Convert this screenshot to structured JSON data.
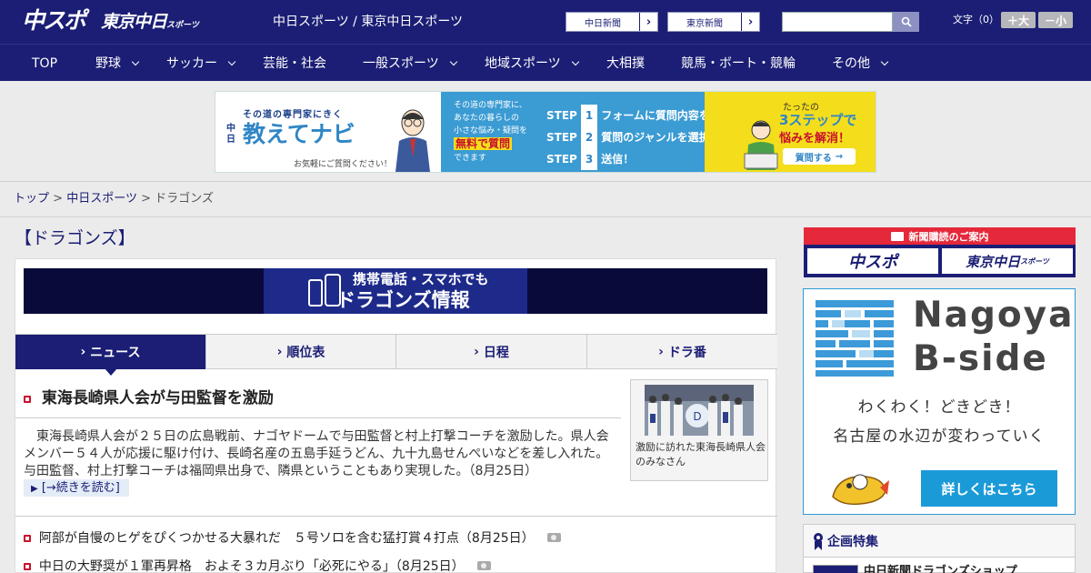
{
  "header": {
    "logo_chunichi_sports": "中スポ",
    "logo_tokyo_chunichi": "東京中日",
    "logo_tokyo_chunichi_small": "スポーツ",
    "site_title": "中日スポーツ / 東京中日スポーツ",
    "paper_links": [
      {
        "label": "中日新聞"
      },
      {
        "label": "東京新聞"
      }
    ],
    "search_value": "",
    "font_size_label": "文字（0）",
    "font_larger": "＋大",
    "font_smaller": "－小"
  },
  "nav": {
    "items": [
      {
        "label": "TOP"
      },
      {
        "label": "野球"
      },
      {
        "label": "サッカー"
      },
      {
        "label": "芸能・社会"
      },
      {
        "label": "一般スポーツ"
      },
      {
        "label": "地域スポーツ"
      },
      {
        "label": "大相撲"
      },
      {
        "label": "競馬・ボート・競輪"
      },
      {
        "label": "その他"
      }
    ]
  },
  "banner": {
    "l_tag": "その道の専門家にきく",
    "l_brand_small": "中日",
    "l_brand": "教えてナビ",
    "l_note": "お気軽にご質問ください！",
    "m_line1": "その道の専門家に、",
    "m_line2": "あなたの暮らしの",
    "m_line3": "小さな悩み・疑問を",
    "m_free": "無料で質問",
    "m_line4": "できます",
    "steps": [
      {
        "label": "STEP",
        "num": "1",
        "text": "フォームに質問内容を入力"
      },
      {
        "label": "STEP",
        "num": "2",
        "text": "質問のジャンルを選択"
      },
      {
        "label": "STEP",
        "num": "3",
        "text": "送信！"
      }
    ],
    "r_line1": "たったの",
    "r_line2": "3ステップで",
    "r_line3": "悩みを解消！",
    "r_btn": "質問する"
  },
  "breadcrumb": {
    "top": "トップ",
    "sep": ">",
    "mid": "中日スポーツ",
    "current": "ドラゴンズ"
  },
  "page_title": "【ドラゴンズ】",
  "mobile_banner": {
    "line1": "携帯電話・スマホでも",
    "line2": "ドラゴンズ情報"
  },
  "tabs": [
    {
      "label": "ニュース"
    },
    {
      "label": "順位表"
    },
    {
      "label": "日程"
    },
    {
      "label": "ドラ番"
    }
  ],
  "lead": {
    "headline": "東海長崎県人会が与田監督を激励",
    "body": "東海長崎県人会が２５日の広島戦前、ナゴヤドームで与田監督と村上打撃コーチを激励した。県人会メンバー５４人が応援に駆け付け、長崎名産の五島手延うどん、九十九島せんぺいなどを差し入れた。与田監督、村上打撃コーチは福岡県出身で、隣県ということもあり実現した。（8月25日）",
    "more": "[→続きを読む]",
    "photo_caption": "激励に訪れた東海長崎県人会のみなさん"
  },
  "news": [
    {
      "title": "阿部が自慢のヒゲをぴくつかせる大暴れだ　５号ソロを含む猛打賞４打点",
      "date": "（8月25日）"
    },
    {
      "title": "中日の大野奨が１軍再昇格　およそ３カ月ぶり「必死にやる」",
      "date": "（8月25日）"
    }
  ],
  "sidebar": {
    "subscribe_title": "新聞購読のご案内",
    "subscribe_a": "中スポ",
    "subscribe_b": "東京中日",
    "subscribe_b_small": "スポーツ",
    "nagoya_line1": "Nagoya",
    "nagoya_line2": "B-side",
    "nagoya_copy1": "わくわく！どきどき！",
    "nagoya_copy2": "名古屋の水辺が変わっていく",
    "nagoya_button": "詳しくはこちら",
    "feature_title": "企画特集",
    "feature_item1": "中日新聞ドラゴンズショップ"
  }
}
